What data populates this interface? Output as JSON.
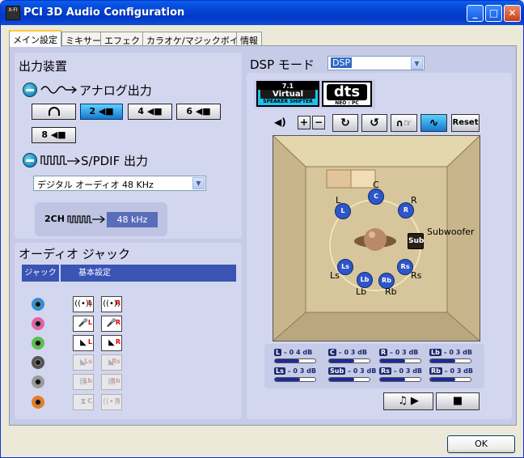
{
  "window": {
    "title": "PCI 3D Audio Configuration",
    "icon_text": "X-FI"
  },
  "titlebar_buttons": {
    "minimize": "_",
    "maximize": "□",
    "close": "✕"
  },
  "tabs": [
    {
      "label": "メイン設定",
      "active": true
    },
    {
      "label": "ミキサー"
    },
    {
      "label": "エフェクト"
    },
    {
      "label": "カラオケ/マジックボイス"
    },
    {
      "label": "情報"
    }
  ],
  "output": {
    "header": "出力装置",
    "analog_label": "アナログ出力",
    "speakers": {
      "headphone": "",
      "two": "2",
      "four": "4",
      "six": "6",
      "eight": "8"
    },
    "spdif_label": "S/PDIF 出力",
    "spdif_select": "デジタル オーディオ 48 KHz",
    "rate_prefix": "2CH",
    "rate_value": "48 kHz"
  },
  "jack": {
    "header": "オーディオ ジャック",
    "col_jack": "ジャック",
    "col_setting": "基本設定",
    "rows": [
      {
        "color": "#2e8fd8",
        "b1": "((•))",
        "t1": "L",
        "b2": "((•))",
        "t2": "R",
        "disabled": false
      },
      {
        "color": "#e85fa4",
        "b1": "🎤",
        "t1": "L",
        "b2": "🎤",
        "t2": "R",
        "disabled": false
      },
      {
        "color": "#57c24a",
        "b1": "◣",
        "t1": "L",
        "b2": "◣",
        "t2": "R",
        "disabled": false
      },
      {
        "color": "#555555",
        "b1": "◣",
        "t1": "Ls",
        "b2": "◣",
        "t2": "Rs",
        "disabled": true
      },
      {
        "color": "#9a9a9a",
        "b1": "▤",
        "t1": "Lb",
        "b2": "▤",
        "t2": "Rb",
        "disabled": true
      },
      {
        "color": "#ee7a1f",
        "b1": "⧗",
        "t1": "C",
        "b2": "((•))",
        "t2": "S",
        "disabled": true
      }
    ]
  },
  "dsp": {
    "mode_label": "DSP モード",
    "mode_select": "DSP",
    "logo_virtual_top": "7.1",
    "logo_virtual_mid": "Virtual",
    "logo_virtual_bottom": "SPEAKER SHIFTER",
    "logo_dts": "dts",
    "logo_dts_sub": "NEO : PC",
    "controls": {
      "speaker_icon": "◀)",
      "plus": "+",
      "minus": "−",
      "rot_cw": "↻",
      "rot_ccw": "↺",
      "headphone": "∩☞",
      "wave": "∿",
      "reset": "Reset"
    }
  },
  "room": {
    "speakers": [
      {
        "id": "L",
        "label": "L"
      },
      {
        "id": "C",
        "label": "C"
      },
      {
        "id": "R",
        "label": "R"
      },
      {
        "id": "Sub",
        "label": "Sub",
        "name": "Subwoofer"
      },
      {
        "id": "Ls",
        "label": "Ls"
      },
      {
        "id": "Rs",
        "label": "Rs"
      },
      {
        "id": "Lb",
        "label": "Lb"
      },
      {
        "id": "Rb",
        "label": "Rb"
      }
    ]
  },
  "volumes": [
    {
      "ch": "L",
      "text": "– 0 4 dB",
      "level": 0.6
    },
    {
      "ch": "C",
      "text": "– 0 3 dB",
      "level": 0.62
    },
    {
      "ch": "R",
      "text": "– 0 3 dB",
      "level": 0.62
    },
    {
      "ch": "Lb",
      "text": "– 0 3 dB",
      "level": 0.62
    },
    {
      "ch": "Ls",
      "text": "– 0 3 dB",
      "level": 0.62
    },
    {
      "ch": "Sub",
      "text": "– 0 3 dB",
      "level": 0.62
    },
    {
      "ch": "Rs",
      "text": "– 0 3 dB",
      "level": 0.62
    },
    {
      "ch": "Rb",
      "text": "– 0 3 dB",
      "level": 0.62
    }
  ],
  "playback": {
    "play": "♫ ▶",
    "stop": "■"
  },
  "ok": "OK"
}
